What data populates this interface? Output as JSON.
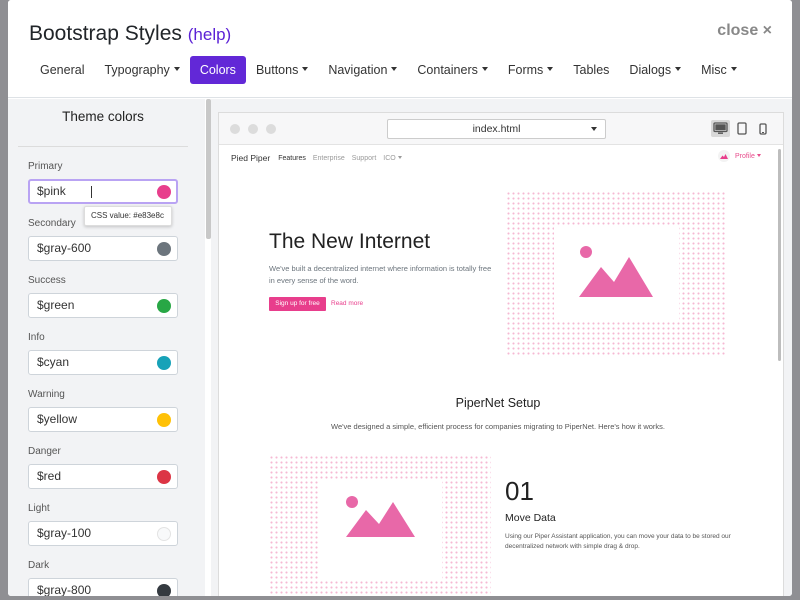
{
  "header": {
    "title": "Bootstrap Styles",
    "help_label": "(help)",
    "close_label": "close ×"
  },
  "tabs": [
    {
      "label": "General",
      "dropdown": false,
      "active": false
    },
    {
      "label": "Typography",
      "dropdown": true,
      "active": false
    },
    {
      "label": "Colors",
      "dropdown": false,
      "active": true
    },
    {
      "label": "Buttons",
      "dropdown": true,
      "active": false
    },
    {
      "label": "Navigation",
      "dropdown": true,
      "active": false
    },
    {
      "label": "Containers",
      "dropdown": true,
      "active": false
    },
    {
      "label": "Forms",
      "dropdown": true,
      "active": false
    },
    {
      "label": "Tables",
      "dropdown": false,
      "active": false
    },
    {
      "label": "Dialogs",
      "dropdown": true,
      "active": false
    },
    {
      "label": "Misc",
      "dropdown": true,
      "active": false
    }
  ],
  "sidebar": {
    "title": "Theme colors",
    "fields": [
      {
        "label": "Primary",
        "value": "$pink",
        "color": "#e83e8c",
        "focused": true
      },
      {
        "label": "Secondary",
        "value": "$gray-600",
        "color": "#6c757d"
      },
      {
        "label": "Success",
        "value": "$green",
        "color": "#28a745"
      },
      {
        "label": "Info",
        "value": "$cyan",
        "color": "#17a2b8"
      },
      {
        "label": "Warning",
        "value": "$yellow",
        "color": "#ffc107"
      },
      {
        "label": "Danger",
        "value": "$red",
        "color": "#dc3545"
      },
      {
        "label": "Light",
        "value": "$gray-100",
        "color": "#f8f9fa"
      },
      {
        "label": "Dark",
        "value": "$gray-800",
        "color": "#343a40"
      }
    ],
    "tooltip": "CSS value: #e83e8c"
  },
  "preview": {
    "url": "index.html",
    "devices": [
      "desktop-icon",
      "tablet-icon",
      "mobile-icon"
    ],
    "site": {
      "brand": "Pied Piper",
      "nav_links": [
        "Features",
        "Enterprise",
        "Support",
        "ICO"
      ],
      "profile_label": "Profile",
      "hero_title": "The New Internet",
      "hero_sub": "We've built a decentralized internet where information is totally free in every sense of the word.",
      "cta_label": "Sign up for free",
      "readmore_label": "Read more",
      "section_title": "PiperNet Setup",
      "section_sub": "We've designed a simple, efficient process for companies migrating to PiperNet. Here's how it works.",
      "step_number": "01",
      "step_title": "Move Data",
      "step_desc": "Using our Piper Assistant application, you can move your data to be stored our decentralized network with simple drag & drop."
    }
  },
  "colors": {
    "accent": "#6228d7",
    "pink": "#e83e8c"
  }
}
